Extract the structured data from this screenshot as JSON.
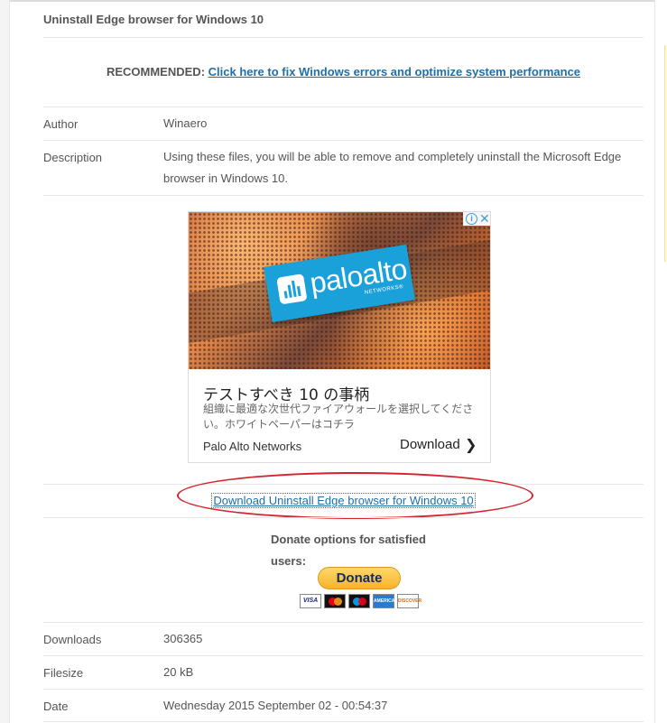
{
  "page": {
    "title": "Uninstall Edge browser for Windows 10"
  },
  "recommended": {
    "label": "RECOMMENDED: ",
    "link_text": "Click here to fix Windows errors and optimize system performance"
  },
  "details_top": [
    {
      "label": "Author",
      "value": "Winaero"
    },
    {
      "label": "Description",
      "value": "Using these files, you will be able to remove and completely uninstall the Microsoft Edge browser in Windows 10."
    }
  ],
  "ad": {
    "brand_word": "paloalto",
    "brand_sub": "NETWORKS®",
    "headline": "テストすべき 10 の事柄",
    "description": "組織に最適な次世代ファイアウォールを選択してください。ホワイトペーパーはコチラ",
    "advertiser": "Palo Alto Networks",
    "cta": "Download",
    "cta_chevron": "❯",
    "info_glyph": "i",
    "close_glyph": "✕",
    "icons": [
      "info-icon",
      "close-icon",
      "chevron-right-icon"
    ]
  },
  "download": {
    "link_text": "Download Uninstall Edge browser for Windows 10",
    "annotation_color": "#d4232d"
  },
  "donate": {
    "title": "Donate options for satisfied users:",
    "button_label": "Donate",
    "cards": [
      "VISA",
      "",
      "",
      "AMERICAN EXPRESS",
      "DISCOVER"
    ]
  },
  "details_bottom": [
    {
      "label": "Downloads",
      "value": "306365"
    },
    {
      "label": "Filesize",
      "value": "20 kB"
    },
    {
      "label": "Date",
      "value": "Wednesday 2015 September 02 - 00:54:37"
    }
  ],
  "colors": {
    "link": "#1e6fa8",
    "text": "#555555",
    "paypal_yellow": "#f7b32b",
    "paloalto_blue": "#1aa1d9"
  }
}
